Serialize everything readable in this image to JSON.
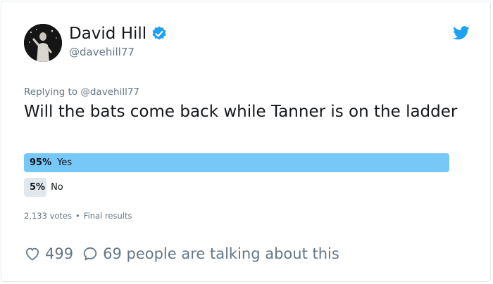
{
  "author": {
    "display_name": "David Hill",
    "handle": "@davehill77"
  },
  "reply": {
    "text": "Replying to @davehill77"
  },
  "tweet": {
    "text": "Will the bats come back while Tanner is on the ladder"
  },
  "poll": {
    "options": [
      {
        "percent_label": "95%",
        "label": "Yes",
        "share": 0.95,
        "winner": true
      },
      {
        "percent_label": "5%",
        "label": "No",
        "share": 0.05,
        "winner": false
      }
    ],
    "votes": "2,133 votes",
    "status": "Final results"
  },
  "engagement": {
    "likes": "499",
    "talking": "69 people are talking about this"
  },
  "colors": {
    "accent": "#1da1f2",
    "winner_bar": "#77c7f7",
    "loser_bar": "#e1e8ed",
    "muted_text": "#657786"
  },
  "icons": {
    "verified": "verified-badge-icon",
    "brand": "twitter-bird-icon",
    "like": "heart-outline-icon",
    "reply": "speech-bubble-icon"
  }
}
